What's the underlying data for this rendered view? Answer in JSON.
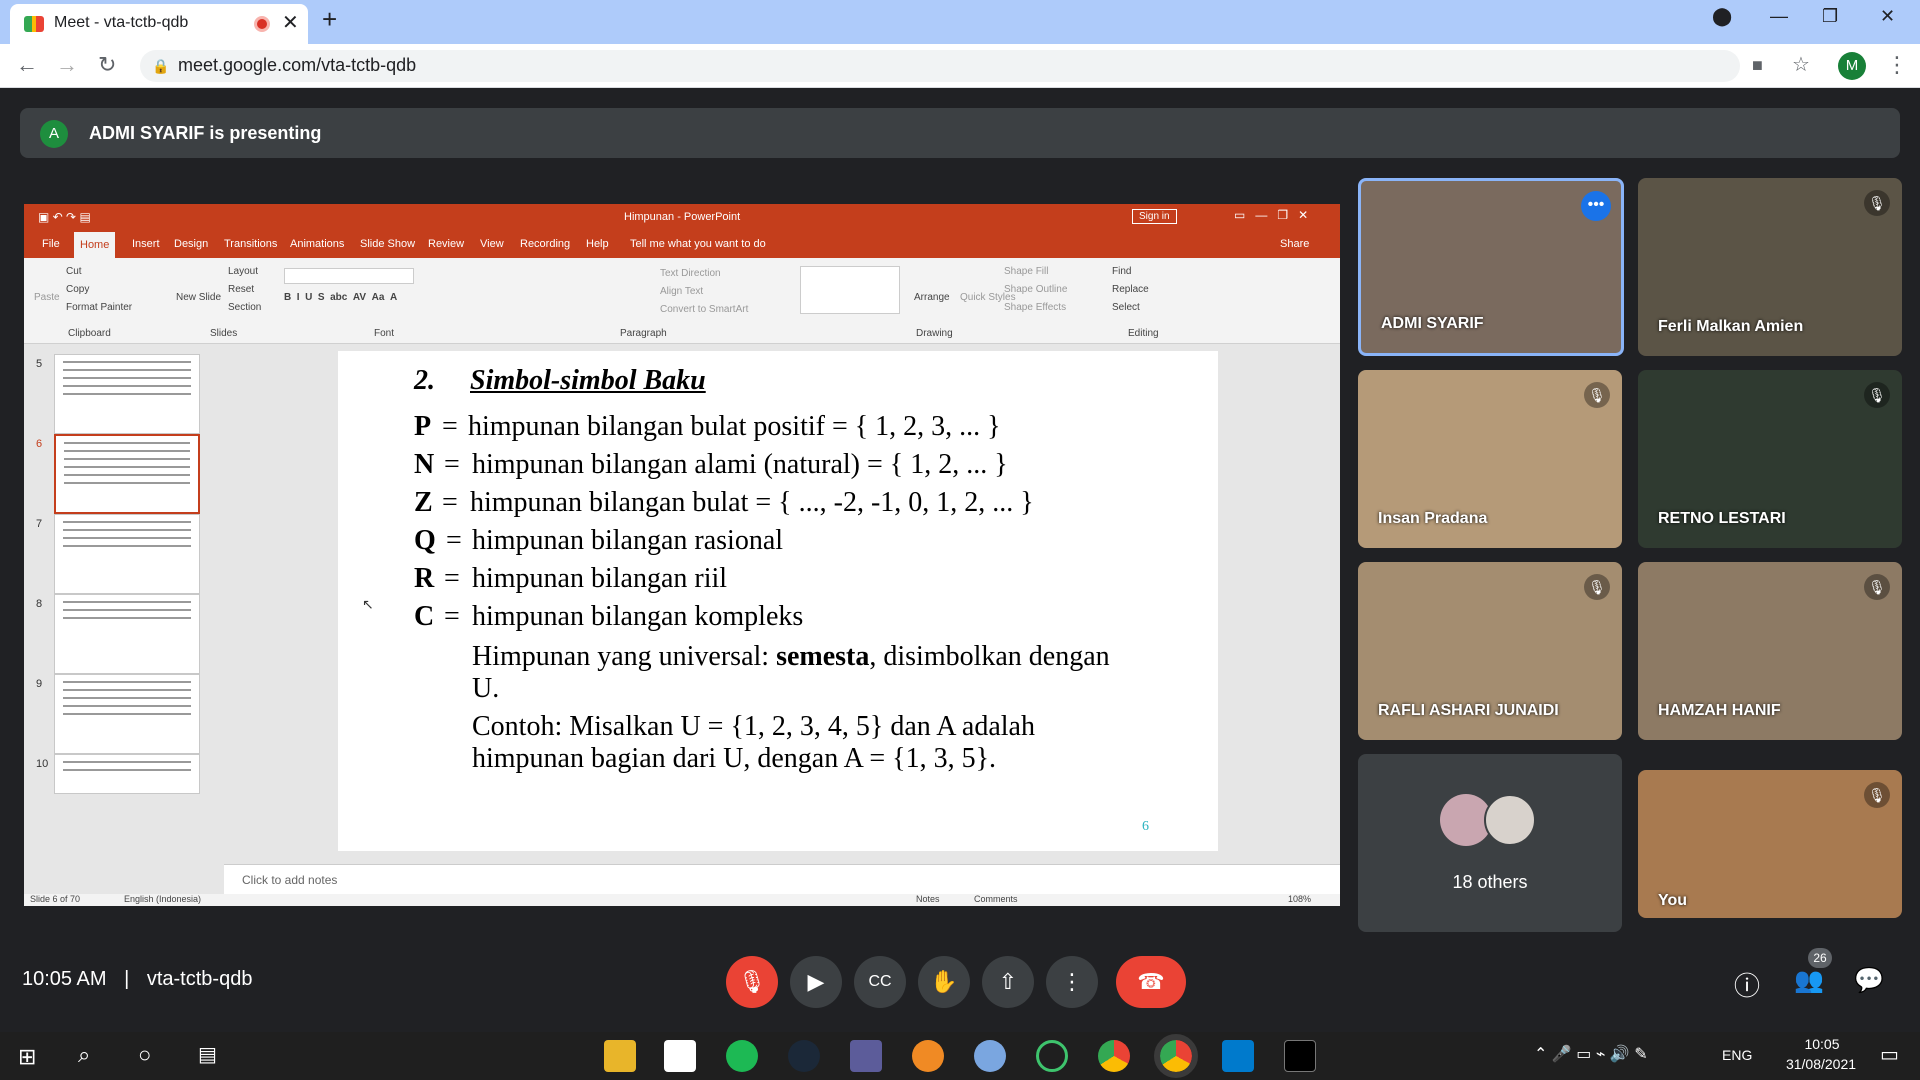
{
  "browser": {
    "tab_title": "Meet - vta-tctb-qdb",
    "url": "meet.google.com/vta-tctb-qdb",
    "profile_initial": "M"
  },
  "meet": {
    "presenter_initial": "A",
    "presenting_text": "ADMI SYARIF is presenting",
    "participants": [
      {
        "name": "ADMI SYARIF"
      },
      {
        "name": "Ferli Malkan Amien"
      },
      {
        "name": "Insan Pradana"
      },
      {
        "name": "RETNO LESTARI"
      },
      {
        "name": "RAFLI ASHARI JUNAIDI"
      },
      {
        "name": "HAMZAH HANIF"
      },
      {
        "name": "18 others"
      },
      {
        "name": "You"
      }
    ],
    "time": "10:05 AM",
    "meeting_code": "vta-tctb-qdb",
    "people_count": "26"
  },
  "ppt": {
    "title": "Himpunan - PowerPoint",
    "sign_in": "Sign in",
    "tabs": [
      "File",
      "Home",
      "Insert",
      "Design",
      "Transitions",
      "Animations",
      "Slide Show",
      "Review",
      "View",
      "Recording",
      "Help",
      "Tell me what you want to do"
    ],
    "share": "Share",
    "ribbon_groups": [
      "Clipboard",
      "Slides",
      "Font",
      "Paragraph",
      "Drawing",
      "Editing"
    ],
    "ribbon_items": [
      "Cut",
      "Copy",
      "Format Painter",
      "Paste",
      "New Slide",
      "Layout",
      "Reset",
      "Section",
      "Find",
      "Replace",
      "Select",
      "Arrange",
      "Quick Styles",
      "Shape Fill",
      "Shape Outline",
      "Shape Effects",
      "Text Direction",
      "Align Text",
      "Convert to SmartArt"
    ],
    "thumb_numbers": [
      "5",
      "6",
      "7",
      "8",
      "9",
      "10"
    ],
    "notes_placeholder": "Click to add notes",
    "status_slide": "Slide 6 of 70",
    "status_lang": "English (Indonesia)",
    "status_notes": "Notes",
    "status_comments": "Comments",
    "zoom": "108%"
  },
  "slide": {
    "number_label": "2.",
    "heading": "Simbol-simbol Baku",
    "rows": [
      {
        "sym": "P",
        "eq": "=",
        "text": "himpunan bilangan bulat positif  =  { 1, 2, 3, ... }"
      },
      {
        "sym": "N",
        "eq": "=",
        "text": "himpunan bilangan alami (natural)  =  { 1, 2, ... }"
      },
      {
        "sym": "Z",
        "eq": "=",
        "text": "himpunan bilangan bulat  =  { ..., -2, -1, 0, 1, 2, ... }"
      },
      {
        "sym": "Q",
        "eq": "=",
        "text": "himpunan bilangan rasional"
      },
      {
        "sym": "R",
        "eq": "=",
        "text": "himpunan bilangan riil"
      },
      {
        "sym": "C",
        "eq": "=",
        "text": "himpunan bilangan kompleks"
      }
    ],
    "universal_pre": "Himpunan yang universal: ",
    "universal_bold": "semesta",
    "universal_post": ", disimbolkan dengan",
    "universal_line2": "U.",
    "example_line1": "Contoh: Misalkan U = {1, 2, 3, 4, 5} dan A adalah",
    "example_line2": "himpunan bagian dari U, dengan A = {1, 3, 5}.",
    "page": "6"
  },
  "taskbar": {
    "lang": "ENG",
    "clock_time": "10:05",
    "clock_date": "31/08/2021"
  },
  "colors": {
    "ppt_accent": "#c43e1c",
    "meet_bg": "#202124",
    "end_call": "#ea4335",
    "mic_off": "#ea4335"
  }
}
